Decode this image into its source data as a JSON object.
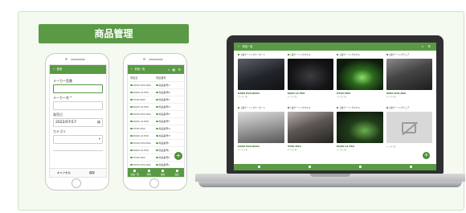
{
  "banner": {
    "title": "商品管理"
  },
  "phone_form": {
    "appbar_title": "登録",
    "fields": [
      {
        "label": "メーカー型番",
        "value": ""
      },
      {
        "label": "メーカー名 *",
        "value": ""
      },
      {
        "label": "発売日",
        "value": "2022/07/17"
      },
      {
        "label": "カテゴリ",
        "value": ""
      }
    ],
    "cancel_label": "キャンセル",
    "save_label": "保存"
  },
  "phone_list": {
    "appbar_title": "商品一覧",
    "col1": "商品名",
    "col2": "商品番号",
    "rows": [
      [
        "DX00 KVS-R0A",
        "商品番号A"
      ],
      [
        "RQ00 LX P0X",
        "商品番号B"
      ],
      [
        "HY00 MSV",
        "商品番号C"
      ],
      [
        "RQ00 LX P0X",
        "商品番号D"
      ],
      [
        "DX00 KVS-R0A",
        "商品番号E"
      ],
      [
        "RQ00 LX P0X",
        "商品番号F"
      ],
      [
        "HY00 MSV",
        "商品番号G"
      ],
      [
        "RQ00 LX P0X",
        "商品番号H"
      ],
      [
        "DX00 KVS-R0A",
        "商品番号I"
      ],
      [
        "RQ00 LX P0X",
        "商品番号J"
      ],
      [
        "HY00 MSV",
        "商品番号K"
      ],
      [
        "DX00 KVS-R0A",
        "商品番号L"
      ]
    ],
    "nav": [
      "商品一覧",
      "登録",
      "検索",
      "設定"
    ]
  },
  "laptop": {
    "appbar_title": "商品一覧",
    "cards": [
      {
        "cat": "上級ゲーミングキーボード",
        "name": "DX00 KVS-R0SA",
        "sub": "メーカー名"
      },
      {
        "cat": "上級ゲーミングマウス",
        "name": "RQ00 LX P0X",
        "sub": "メーカー名"
      },
      {
        "cat": "上級ゲーミングマウス",
        "name": "HY00 MSV",
        "sub": "メーカー名"
      },
      {
        "cat": "上級ゲーミングチェア",
        "name": "DX00 KVS-R0A",
        "sub": "メーカー名"
      },
      {
        "cat": "上級ゲーミングキーボード",
        "name": "DX00 KVS-R0SA",
        "sub": "メーカー名"
      },
      {
        "cat": "上級ゲーミングマウス",
        "name": "HY00 MSV",
        "sub": "メーカー名"
      },
      {
        "cat": "上級ゲーミングマウス",
        "name": "RQ00 LX P0X",
        "sub": "メーカー名"
      },
      {
        "cat": "上級ゲーミングチェア",
        "name": "",
        "sub": "メーカー名"
      }
    ]
  },
  "colors": {
    "accent": "#5a9a45",
    "background": "#f4faef"
  }
}
